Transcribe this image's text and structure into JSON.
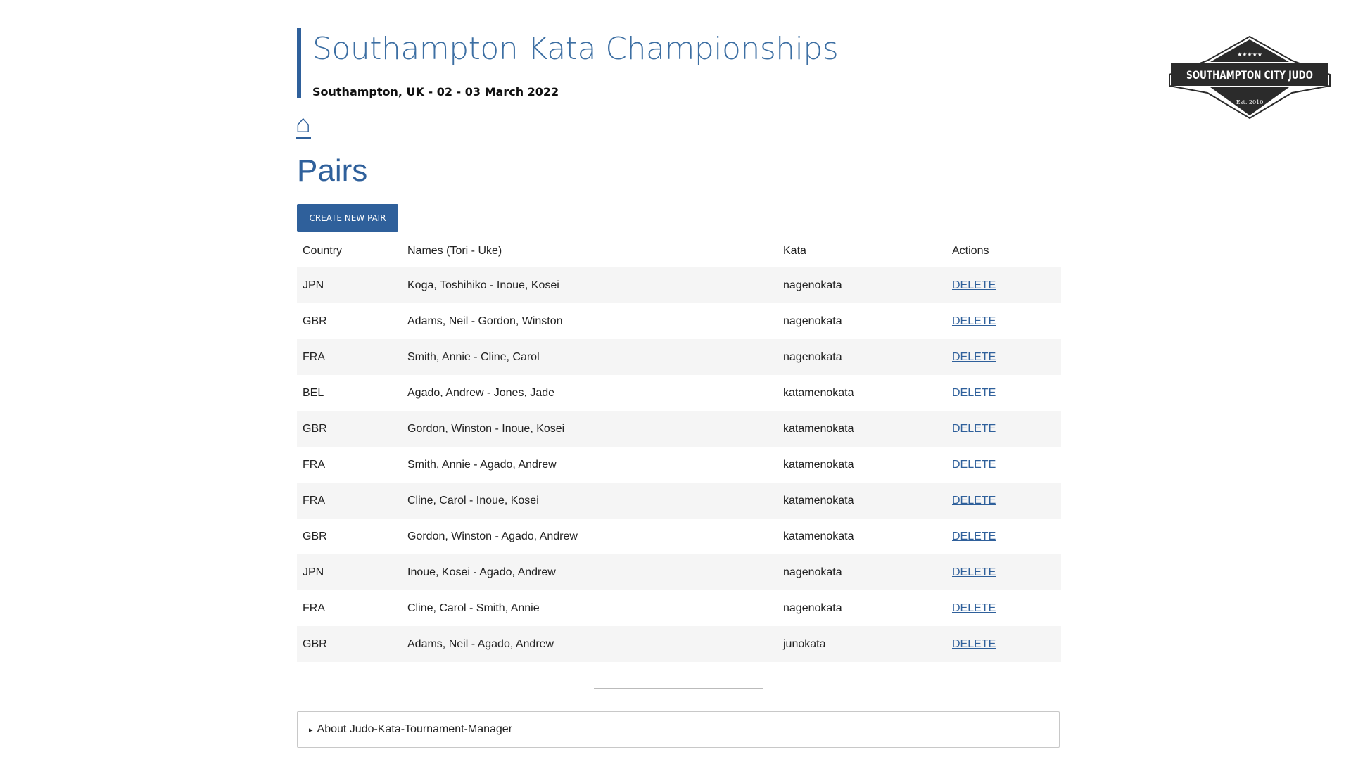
{
  "header": {
    "title": "Southampton Kata Championships",
    "subtitle": "Southampton, UK - 02 - 03 March 2022"
  },
  "logo": {
    "stars": "★★★★★",
    "name": "SOUTHAMPTON CITY JUDO",
    "established": "Est. 2010",
    "colors": {
      "dark": "#2b2b2b",
      "light": "#ffffff"
    }
  },
  "nav": {
    "home_icon": "⌂"
  },
  "page": {
    "heading": "Pairs",
    "create_button": "CREATE NEW PAIR"
  },
  "table": {
    "headers": {
      "country": "Country",
      "names": "Names (Tori - Uke)",
      "kata": "Kata",
      "actions": "Actions"
    },
    "rows": [
      {
        "country": "JPN",
        "names": "Koga, Toshihiko - Inoue, Kosei",
        "kata": "nagenokata",
        "action": "DELETE"
      },
      {
        "country": "GBR",
        "names": "Adams, Neil - Gordon, Winston",
        "kata": "nagenokata",
        "action": "DELETE"
      },
      {
        "country": "FRA",
        "names": "Smith, Annie - Cline, Carol",
        "kata": "nagenokata",
        "action": "DELETE"
      },
      {
        "country": "BEL",
        "names": "Agado, Andrew - Jones, Jade",
        "kata": "katamenokata",
        "action": "DELETE"
      },
      {
        "country": "GBR",
        "names": "Gordon, Winston - Inoue, Kosei",
        "kata": "katamenokata",
        "action": "DELETE"
      },
      {
        "country": "FRA",
        "names": "Smith, Annie - Agado, Andrew",
        "kata": "katamenokata",
        "action": "DELETE"
      },
      {
        "country": "FRA",
        "names": "Cline, Carol - Inoue, Kosei",
        "kata": "katamenokata",
        "action": "DELETE"
      },
      {
        "country": "GBR",
        "names": "Gordon, Winston - Agado, Andrew",
        "kata": "katamenokata",
        "action": "DELETE"
      },
      {
        "country": "JPN",
        "names": "Inoue, Kosei - Agado, Andrew",
        "kata": "nagenokata",
        "action": "DELETE"
      },
      {
        "country": "FRA",
        "names": "Cline, Carol - Smith, Annie",
        "kata": "nagenokata",
        "action": "DELETE"
      },
      {
        "country": "GBR",
        "names": "Adams, Neil - Agado, Andrew",
        "kata": "junokata",
        "action": "DELETE"
      }
    ]
  },
  "footer": {
    "about_arrow": "▸",
    "about_label": "About Judo-Kata-Tournament-Manager"
  },
  "colors": {
    "accent": "#2f609b",
    "row_stripe": "#f5f5f5"
  }
}
